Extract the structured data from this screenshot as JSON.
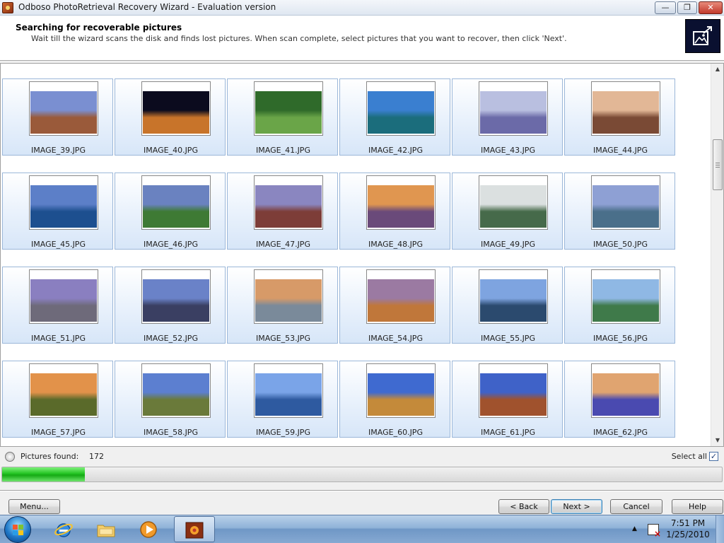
{
  "window": {
    "title": "Odboso PhotoRetrieval Recovery Wizard - Evaluation version",
    "minimize": "—",
    "maximize": "❐",
    "close": "✕"
  },
  "header": {
    "title": "Searching for recoverable pictures",
    "description": "Wait till the wizard scans the disk and finds lost pictures. When scan complete, select pictures that you want to recover, then click 'Next'."
  },
  "gallery": {
    "items": [
      {
        "label": "IMAGE_39.JPG",
        "sky": "#7a8fd1",
        "ground": "#9a5a3a"
      },
      {
        "label": "IMAGE_40.JPG",
        "sky": "#0b0b1e",
        "ground": "#c8742a"
      },
      {
        "label": "IMAGE_41.JPG",
        "sky": "#2f6a2a",
        "ground": "#6aa548"
      },
      {
        "label": "IMAGE_42.JPG",
        "sky": "#3a7fd0",
        "ground": "#1b6d7c"
      },
      {
        "label": "IMAGE_43.JPG",
        "sky": "#b9bfe0",
        "ground": "#6b6aa8"
      },
      {
        "label": "IMAGE_44.JPG",
        "sky": "#e2b796",
        "ground": "#7a4a35"
      },
      {
        "label": "IMAGE_45.JPG",
        "sky": "#5c7fc8",
        "ground": "#1d4f8f"
      },
      {
        "label": "IMAGE_46.JPG",
        "sky": "#6a82c0",
        "ground": "#3e7a34"
      },
      {
        "label": "IMAGE_47.JPG",
        "sky": "#8a86c0",
        "ground": "#7d3d38"
      },
      {
        "label": "IMAGE_48.JPG",
        "sky": "#e09650",
        "ground": "#6a4a7a"
      },
      {
        "label": "IMAGE_49.JPG",
        "sky": "#dbe0e0",
        "ground": "#466a4a"
      },
      {
        "label": "IMAGE_50.JPG",
        "sky": "#8ea0d4",
        "ground": "#4a6f8a"
      },
      {
        "label": "IMAGE_51.JPG",
        "sky": "#8a7fc0",
        "ground": "#6e6a7a"
      },
      {
        "label": "IMAGE_52.JPG",
        "sky": "#6a82c8",
        "ground": "#3a3f62"
      },
      {
        "label": "IMAGE_53.JPG",
        "sky": "#d79a68",
        "ground": "#7a8a9a"
      },
      {
        "label": "IMAGE_54.JPG",
        "sky": "#9b7aa2",
        "ground": "#c0773a"
      },
      {
        "label": "IMAGE_55.JPG",
        "sky": "#7ea4e0",
        "ground": "#2b4a6e"
      },
      {
        "label": "IMAGE_56.JPG",
        "sky": "#8fb8e4",
        "ground": "#3f7a4a"
      },
      {
        "label": "IMAGE_57.JPG",
        "sky": "#e2924a",
        "ground": "#5a6a2a"
      },
      {
        "label": "IMAGE_58.JPG",
        "sky": "#5c7fd0",
        "ground": "#6a7a3a"
      },
      {
        "label": "IMAGE_59.JPG",
        "sky": "#7aa4e8",
        "ground": "#2e5aa0"
      },
      {
        "label": "IMAGE_60.JPG",
        "sky": "#3f6ad0",
        "ground": "#c48a3a"
      },
      {
        "label": "IMAGE_61.JPG",
        "sky": "#3f62c8",
        "ground": "#a0522d"
      },
      {
        "label": "IMAGE_62.JPG",
        "sky": "#e0a470",
        "ground": "#4a4ab0"
      }
    ]
  },
  "status": {
    "pictures_found_label": "Pictures found:",
    "pictures_found_value": "172",
    "select_all_label": "Select all",
    "select_all_checked": true,
    "check_glyph": "✓",
    "progress_fraction": 0.115
  },
  "buttons": {
    "menu": "Menu...",
    "back": "< Back",
    "next": "Next >",
    "cancel": "Cancel",
    "help": "Help"
  },
  "scrollbar": {
    "up_glyph": "▲",
    "down_glyph": "▼"
  },
  "taskbar": {
    "items": [
      "start-orb",
      "internet-explorer-icon",
      "file-explorer-icon",
      "media-player-icon",
      "photoretrieval-app-icon"
    ],
    "tray_arrow": "▲",
    "time": "7:51 PM",
    "date": "1/25/2010"
  },
  "colors": {
    "progress_green": "#22c322",
    "thumb_border": "#9bb7d9",
    "next_button_focus": "#3c7fb1"
  }
}
